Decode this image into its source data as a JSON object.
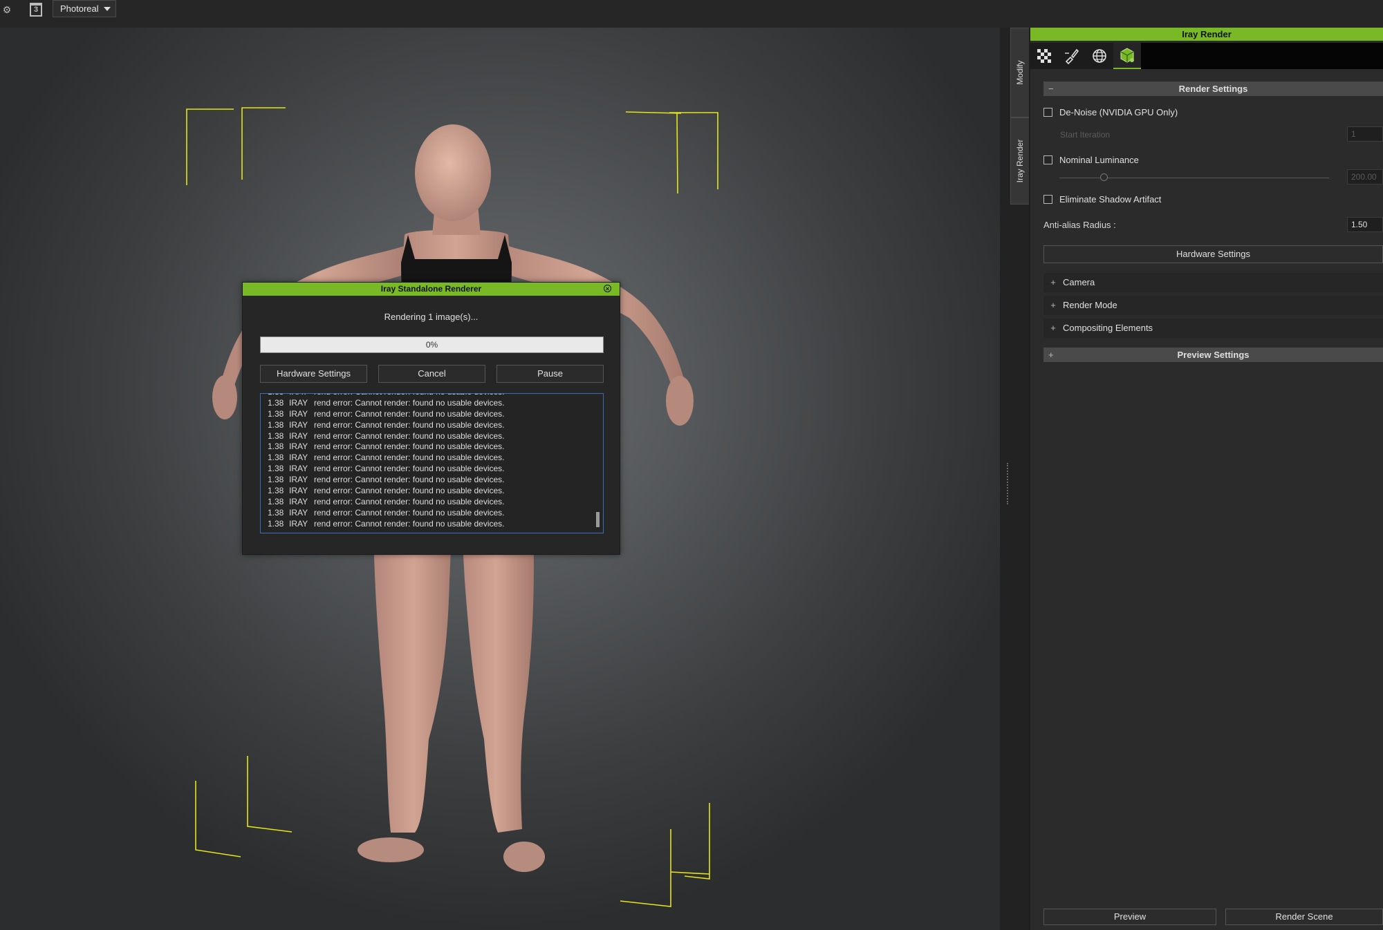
{
  "toolbar": {
    "render_mode_dropdown": "Photoreal",
    "calendar_icon_glyph": "3"
  },
  "dialog": {
    "title": "Iray Standalone Renderer",
    "status": "Rendering 1 image(s)...",
    "progress_percent": 0,
    "progress_text": "0%",
    "buttons": {
      "hardware_settings": "Hardware Settings",
      "cancel": "Cancel",
      "pause": "Pause"
    },
    "log": [
      {
        "time": "1.38",
        "source": "IRAY",
        "message": "rend error: Cannot render: found no usable devices."
      },
      {
        "time": "1.38",
        "source": "IRAY",
        "message": "rend error: Cannot render: found no usable devices."
      },
      {
        "time": "1.38",
        "source": "IRAY",
        "message": "rend error: Cannot render: found no usable devices."
      },
      {
        "time": "1.38",
        "source": "IRAY",
        "message": "rend error: Cannot render: found no usable devices."
      },
      {
        "time": "1.38",
        "source": "IRAY",
        "message": "rend error: Cannot render: found no usable devices."
      },
      {
        "time": "1.38",
        "source": "IRAY",
        "message": "rend error: Cannot render: found no usable devices."
      },
      {
        "time": "1.38",
        "source": "IRAY",
        "message": "rend error: Cannot render: found no usable devices."
      },
      {
        "time": "1.38",
        "source": "IRAY",
        "message": "rend error: Cannot render: found no usable devices."
      },
      {
        "time": "1.38",
        "source": "IRAY",
        "message": "rend error: Cannot render: found no usable devices."
      },
      {
        "time": "1.38",
        "source": "IRAY",
        "message": "rend error: Cannot render: found no usable devices."
      },
      {
        "time": "1.38",
        "source": "IRAY",
        "message": "rend error: Cannot render: found no usable devices."
      },
      {
        "time": "1.38",
        "source": "IRAY",
        "message": "rend error: Cannot render: found no usable devices."
      },
      {
        "time": "1.38",
        "source": "IRAY",
        "message": "rend error: Cannot render: found no usable devices."
      }
    ]
  },
  "side_tabs": {
    "modify": "Modify",
    "iray_render": "Iray Render"
  },
  "panel": {
    "title": "Iray Render",
    "icons": [
      "checker-icon",
      "brush-icon",
      "globe-icon",
      "iray-cube-icon"
    ],
    "render_settings": {
      "header": "Render Settings",
      "toggle": "−",
      "denoise_label": "De-Noise (NVIDIA GPU Only)",
      "start_iteration_label": "Start Iteration",
      "start_iteration_value": "1",
      "nominal_luminance_label": "Nominal Luminance",
      "nominal_luminance_value": "200.00",
      "eliminate_shadow_label": "Eliminate Shadow Artifact",
      "antialias_label": "Anti-alias Radius :",
      "antialias_value": "1.50",
      "hardware_settings_button": "Hardware Settings"
    },
    "collapsibles": [
      {
        "plus": "+",
        "label": "Camera"
      },
      {
        "plus": "+",
        "label": "Render Mode"
      },
      {
        "plus": "+",
        "label": "Compositing Elements"
      }
    ],
    "preview_settings": {
      "header": "Preview Settings",
      "toggle": "+"
    },
    "bottom": {
      "preview": "Preview",
      "render_scene": "Render Scene"
    }
  },
  "colors": {
    "accent_green": "#79b926",
    "bounding_box_yellow": "#e6e619"
  }
}
